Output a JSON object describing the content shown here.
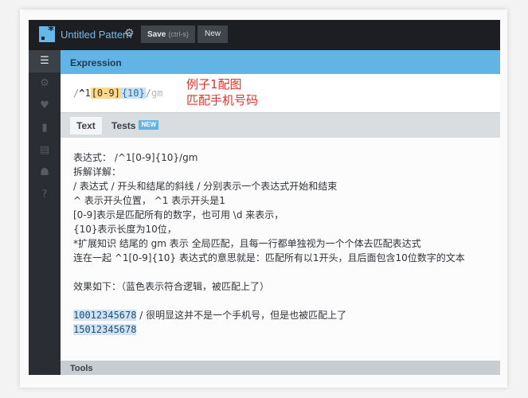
{
  "header": {
    "title": "Untitled Pattern",
    "save_label": "Save",
    "save_hint": "(ctrl-s)",
    "new_label": "New"
  },
  "sidebar": {
    "items": [
      {
        "icon": "list-icon",
        "glyph": "☰",
        "active": true
      },
      {
        "icon": "gear-icon",
        "glyph": "⚙",
        "active": false
      },
      {
        "icon": "heart-icon",
        "glyph": "♥",
        "active": false
      },
      {
        "icon": "bookmark-icon",
        "glyph": "▮",
        "active": false
      },
      {
        "icon": "book-icon",
        "glyph": "▤",
        "active": false
      },
      {
        "icon": "community-icon",
        "glyph": "☗",
        "active": false
      },
      {
        "icon": "help-icon",
        "glyph": "?",
        "active": false
      }
    ]
  },
  "expression": {
    "heading": "Expression",
    "regex": {
      "open": "/",
      "anchor": "^",
      "literal": "1",
      "set": "[0-9]",
      "quantifier": "{10}",
      "close": "/",
      "flags": "gm"
    },
    "annotation_line1": "例子1配图",
    "annotation_line2": "匹配手机号码"
  },
  "tabs": {
    "text_label": "Text",
    "tests_label": "Tests",
    "tests_badge": "NEW"
  },
  "text_content": {
    "lines": [
      "表达式：  /^1[0-9]{10}/gm",
      "拆解详解：",
      "/ 表达式 / 开头和结尾的斜线 / 分别表示一个表达式开始和结束",
      "^ 表示开头位置， ^1 表示开头是1",
      "[0-9]表示是匹配所有的数字，也可用 \\d 来表示，",
      "{10}表示长度为10位，",
      "*扩展知识 结尾的 gm 表示 全局匹配，且每一行都单独视为一个个体去匹配表达式",
      "连在一起 ^1[0-9]{10} 表达式的意思就是：匹配所有以1开头，且后面包含10位数字的文本",
      "",
      "效果如下：（蓝色表示符合逻辑，被匹配上了）",
      ""
    ],
    "match1": "10012345678",
    "match1_note": "  / 很明显这并不是一个手机号，但是也被匹配上了",
    "match2": "15012345678"
  },
  "tools": {
    "label": "Tools"
  }
}
